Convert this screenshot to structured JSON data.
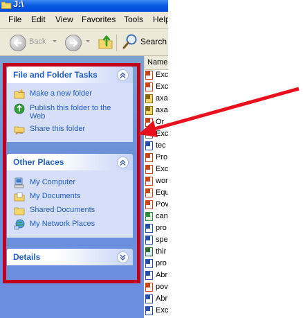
{
  "window": {
    "title": "J:\\"
  },
  "menu": [
    "File",
    "Edit",
    "View",
    "Favorites",
    "Tools",
    "Help"
  ],
  "toolbar": {
    "back_label": "Back",
    "search_label": "Search"
  },
  "list_header": "Name",
  "files": [
    {
      "name": "Exc",
      "icon": "ppt-file-icon"
    },
    {
      "name": "Exc",
      "icon": "ppt-file-icon"
    },
    {
      "name": "axa",
      "icon": "zip-file-icon"
    },
    {
      "name": "axa",
      "icon": "zip-file-icon"
    },
    {
      "name": "Or",
      "icon": "ppt-file-icon"
    },
    {
      "name": "Exc",
      "icon": "generic-file-icon"
    },
    {
      "name": "tec",
      "icon": "word-file-icon"
    },
    {
      "name": "Pro",
      "icon": "ppt-file-icon"
    },
    {
      "name": "Exc",
      "icon": "ppt-file-icon"
    },
    {
      "name": "wor",
      "icon": "ppt-file-icon"
    },
    {
      "name": "Equ",
      "icon": "ppt-file-icon"
    },
    {
      "name": "Pov",
      "icon": "ppt-file-icon"
    },
    {
      "name": "can",
      "icon": "image-file-icon"
    },
    {
      "name": "pro",
      "icon": "word-file-icon"
    },
    {
      "name": "spe",
      "icon": "word-file-icon"
    },
    {
      "name": "thir",
      "icon": "program-file-icon"
    },
    {
      "name": "pro",
      "icon": "word-file-icon"
    },
    {
      "name": "Abr",
      "icon": "word-file-icon"
    },
    {
      "name": "pov",
      "icon": "ppt-file-icon"
    },
    {
      "name": "Abr",
      "icon": "word-file-icon"
    },
    {
      "name": "Exc",
      "icon": "word-file-icon"
    }
  ],
  "panels": {
    "file_folder_tasks": {
      "title": "File and Folder Tasks",
      "items": [
        {
          "label": "Make a new folder",
          "icon": "new-folder-icon"
        },
        {
          "label": "Publish this folder to the Web",
          "icon": "web-publish-icon"
        },
        {
          "label": "Share this folder",
          "icon": "share-folder-icon"
        }
      ]
    },
    "other_places": {
      "title": "Other Places",
      "items": [
        {
          "label": "My Computer",
          "icon": "computer-icon"
        },
        {
          "label": "My Documents",
          "icon": "documents-folder-icon"
        },
        {
          "label": "Shared Documents",
          "icon": "shared-folder-icon"
        },
        {
          "label": "My Network Places",
          "icon": "network-icon"
        }
      ]
    },
    "details": {
      "title": "Details"
    }
  },
  "colors": {
    "task_pane_bg": "#6b8fe0",
    "panel_body": "#d6dff7",
    "panel_title": "#215dc6",
    "highlight_red": "#c1001c"
  }
}
